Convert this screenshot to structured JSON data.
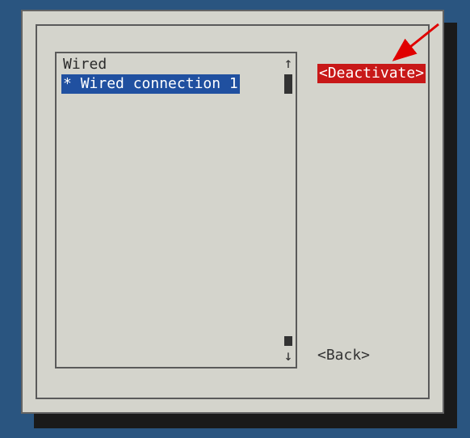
{
  "list": {
    "header": "Wired",
    "selected_prefix": "* ",
    "selected_item": "Wired connection 1"
  },
  "scrollbar": {
    "up_arrow": "↑",
    "down_arrow": "↓"
  },
  "buttons": {
    "deactivate": "<Deactivate>",
    "back": "<Back>"
  }
}
